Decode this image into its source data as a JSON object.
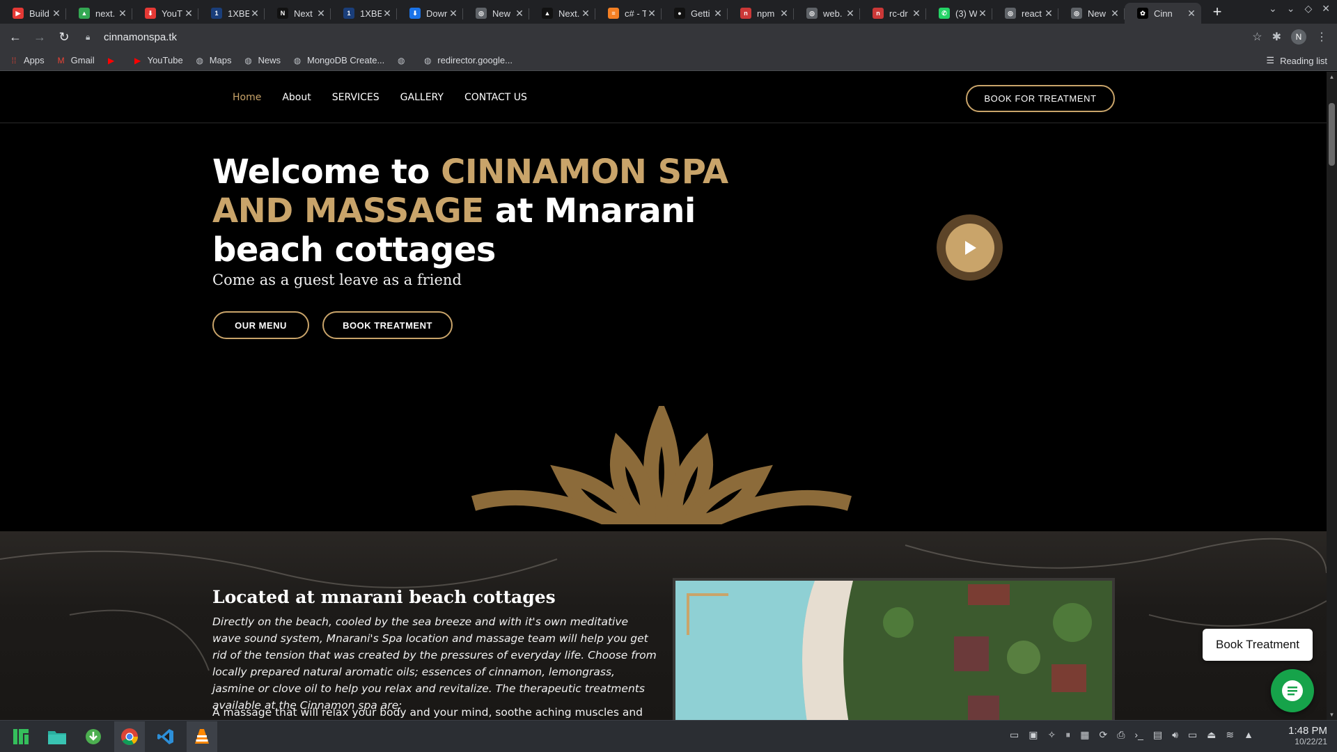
{
  "browser": {
    "tabs": [
      {
        "title": "Build",
        "color": "#e53935",
        "glyph": "▶"
      },
      {
        "title": "next.",
        "color": "#34a853",
        "glyph": "▲"
      },
      {
        "title": "YouT",
        "color": "#e53935",
        "glyph": "⬇"
      },
      {
        "title": "1XBE",
        "color": "#1a3e7a",
        "glyph": "1"
      },
      {
        "title": "Next",
        "color": "#111111",
        "glyph": "N"
      },
      {
        "title": "1XBE",
        "color": "#1a3e7a",
        "glyph": "1"
      },
      {
        "title": "Dowr",
        "color": "#1a73e8",
        "glyph": "⬇"
      },
      {
        "title": "New",
        "color": "#5f6368",
        "glyph": "◎"
      },
      {
        "title": "Next.",
        "color": "#111111",
        "glyph": "▲"
      },
      {
        "title": "c# - T",
        "color": "#f48024",
        "glyph": "≡"
      },
      {
        "title": "Getti",
        "color": "#111111",
        "glyph": "●"
      },
      {
        "title": "npm",
        "color": "#cb3837",
        "glyph": "n"
      },
      {
        "title": "web.",
        "color": "#5f6368",
        "glyph": "◎"
      },
      {
        "title": "rc-dr",
        "color": "#cb3837",
        "glyph": "n"
      },
      {
        "title": "(3) W",
        "color": "#25d366",
        "glyph": "✆"
      },
      {
        "title": "react",
        "color": "#5f6368",
        "glyph": "◎"
      },
      {
        "title": "New",
        "color": "#5f6368",
        "glyph": "◎"
      },
      {
        "title": "Cinn",
        "color": "#000000",
        "glyph": "✿",
        "active": true
      }
    ],
    "url": "cinnamonspa.tk",
    "profile_initial": "N",
    "bookmarks": [
      {
        "label": "Apps",
        "icon": "apps-grid-icon"
      },
      {
        "label": "Gmail",
        "icon": "gmail-icon"
      },
      {
        "label": "",
        "icon": "youtube-icon"
      },
      {
        "label": "YouTube",
        "icon": "youtube-icon"
      },
      {
        "label": "Maps",
        "icon": "globe-icon"
      },
      {
        "label": "News",
        "icon": "globe-icon"
      },
      {
        "label": "MongoDB Create...",
        "icon": "globe-icon"
      },
      {
        "label": "",
        "icon": "globe-icon"
      },
      {
        "label": "redirector.google...",
        "icon": "globe-icon"
      }
    ],
    "reading_list": "Reading list"
  },
  "site": {
    "nav": {
      "links": [
        "Home",
        "About",
        "SERVICES",
        "GALLERY",
        "CONTACT US"
      ],
      "book_button": "BOOK FOR TREATMENT"
    },
    "hero": {
      "title_prefix": "Welcome to ",
      "title_highlight": "CINNAMON SPA AND MASSAGE",
      "title_suffix": " at Mnarani beach cottages",
      "subtitle": "Come as a guest leave as a friend",
      "menu_button": "OUR MENU",
      "book_button": "BOOK TREATMENT"
    },
    "about": {
      "title": "Located at mnarani beach cottages",
      "text": "Directly on the beach, cooled by the sea breeze and with it's own meditative wave sound system, Mnarani's Spa location and massage team will help you get rid of the tension that was created by the pressures of everyday life. Choose from locally prepared natural aromatic oils; essences of cinnamon, lemongrass, jasmine or clove oil to help you relax and revitalize. The therapeutic treatments available at the Cinnamon spa are:",
      "text2": "A massage that will relax your body and your mind, soothe aching muscles and help"
    },
    "floating": {
      "book_label": "Book Treatment"
    },
    "colors": {
      "accent": "#c9a46a",
      "background": "#000000",
      "chat": "#16a34a"
    }
  },
  "taskbar": {
    "apps": [
      "manjaro-icon",
      "file-manager-icon",
      "download-icon",
      "chrome-icon",
      "vscode-icon",
      "vlc-icon"
    ],
    "time": "1:48 PM",
    "date": "10/22/21"
  }
}
